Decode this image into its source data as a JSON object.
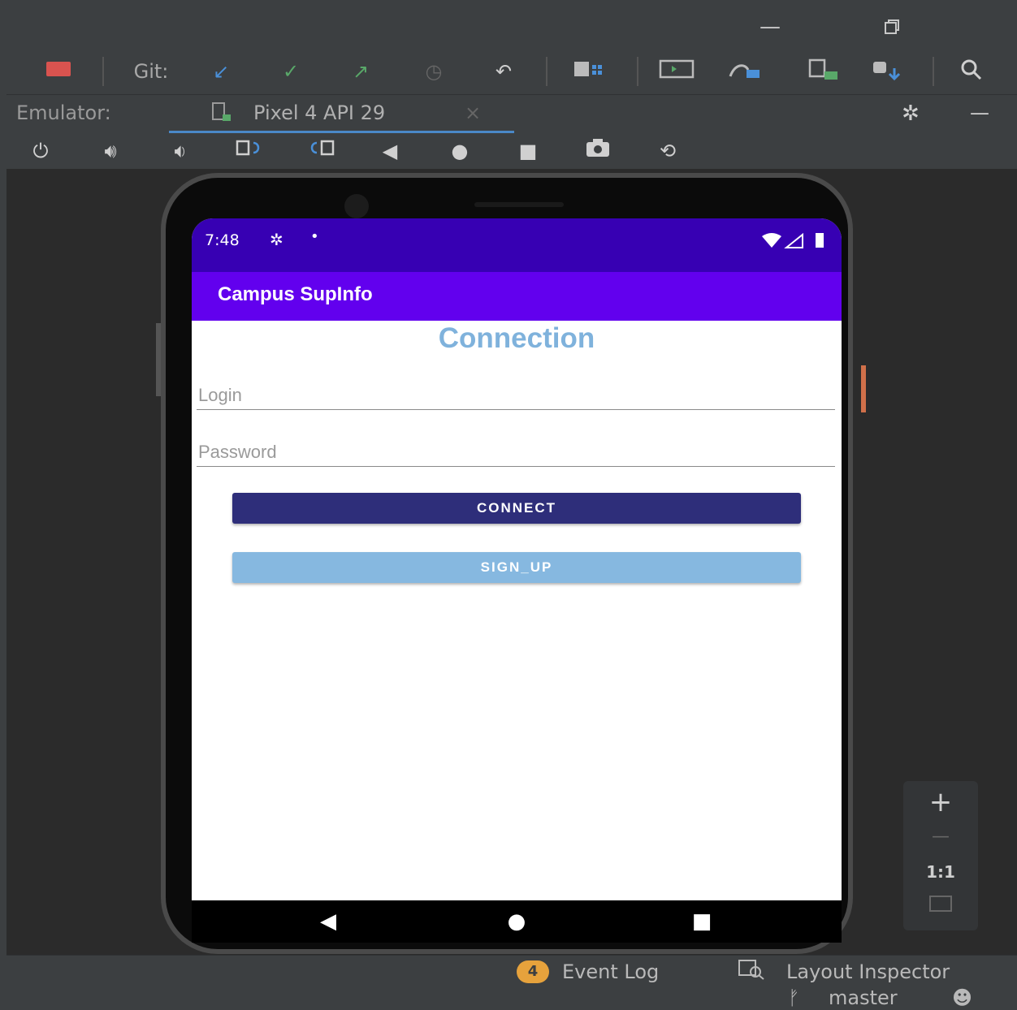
{
  "window": {
    "minimize_icon": "minimize-icon",
    "restore_icon": "restore-icon"
  },
  "toolbar": {
    "git_label": "Git:",
    "icons": [
      "stop-icon",
      "git-update-icon",
      "git-commit-icon",
      "git-push-icon",
      "git-history-icon",
      "undo-icon",
      "project-structure-icon",
      "emulator-icon",
      "device-manager-icon",
      "sync-icon",
      "sdk-manager-icon",
      "search-icon"
    ]
  },
  "emulator_tabs": {
    "label": "Emulator:",
    "device_tab": "Pixel 4 API 29",
    "close_glyph": "×"
  },
  "emulator_controls": [
    "power-icon",
    "volume-up-icon",
    "volume-down-icon",
    "rotate-left-icon",
    "rotate-right-icon",
    "back-icon",
    "home-icon",
    "overview-icon",
    "screenshot-icon",
    "snapshot-icon"
  ],
  "phone": {
    "status_time": "7:48",
    "app_title": "Campus SupInfo",
    "screen_title": "Connection",
    "login_placeholder": "Login",
    "password_placeholder": "Password",
    "connect_label": "CONNECT",
    "signup_label": "SIGN_UP",
    "colors": {
      "status_bar": "#3700b3",
      "app_bar": "#6200ee",
      "connect_button": "#2e2e7a",
      "signup_button": "#86b8e0",
      "title_text": "#7fb2dc"
    }
  },
  "zoom_panel": {
    "zoom_in": "+",
    "zoom_out": "—",
    "actual_size": "1:1"
  },
  "bottom_bar": {
    "event_count": "4",
    "event_log": "Event Log",
    "layout_inspector": "Layout Inspector",
    "branch": "master"
  }
}
